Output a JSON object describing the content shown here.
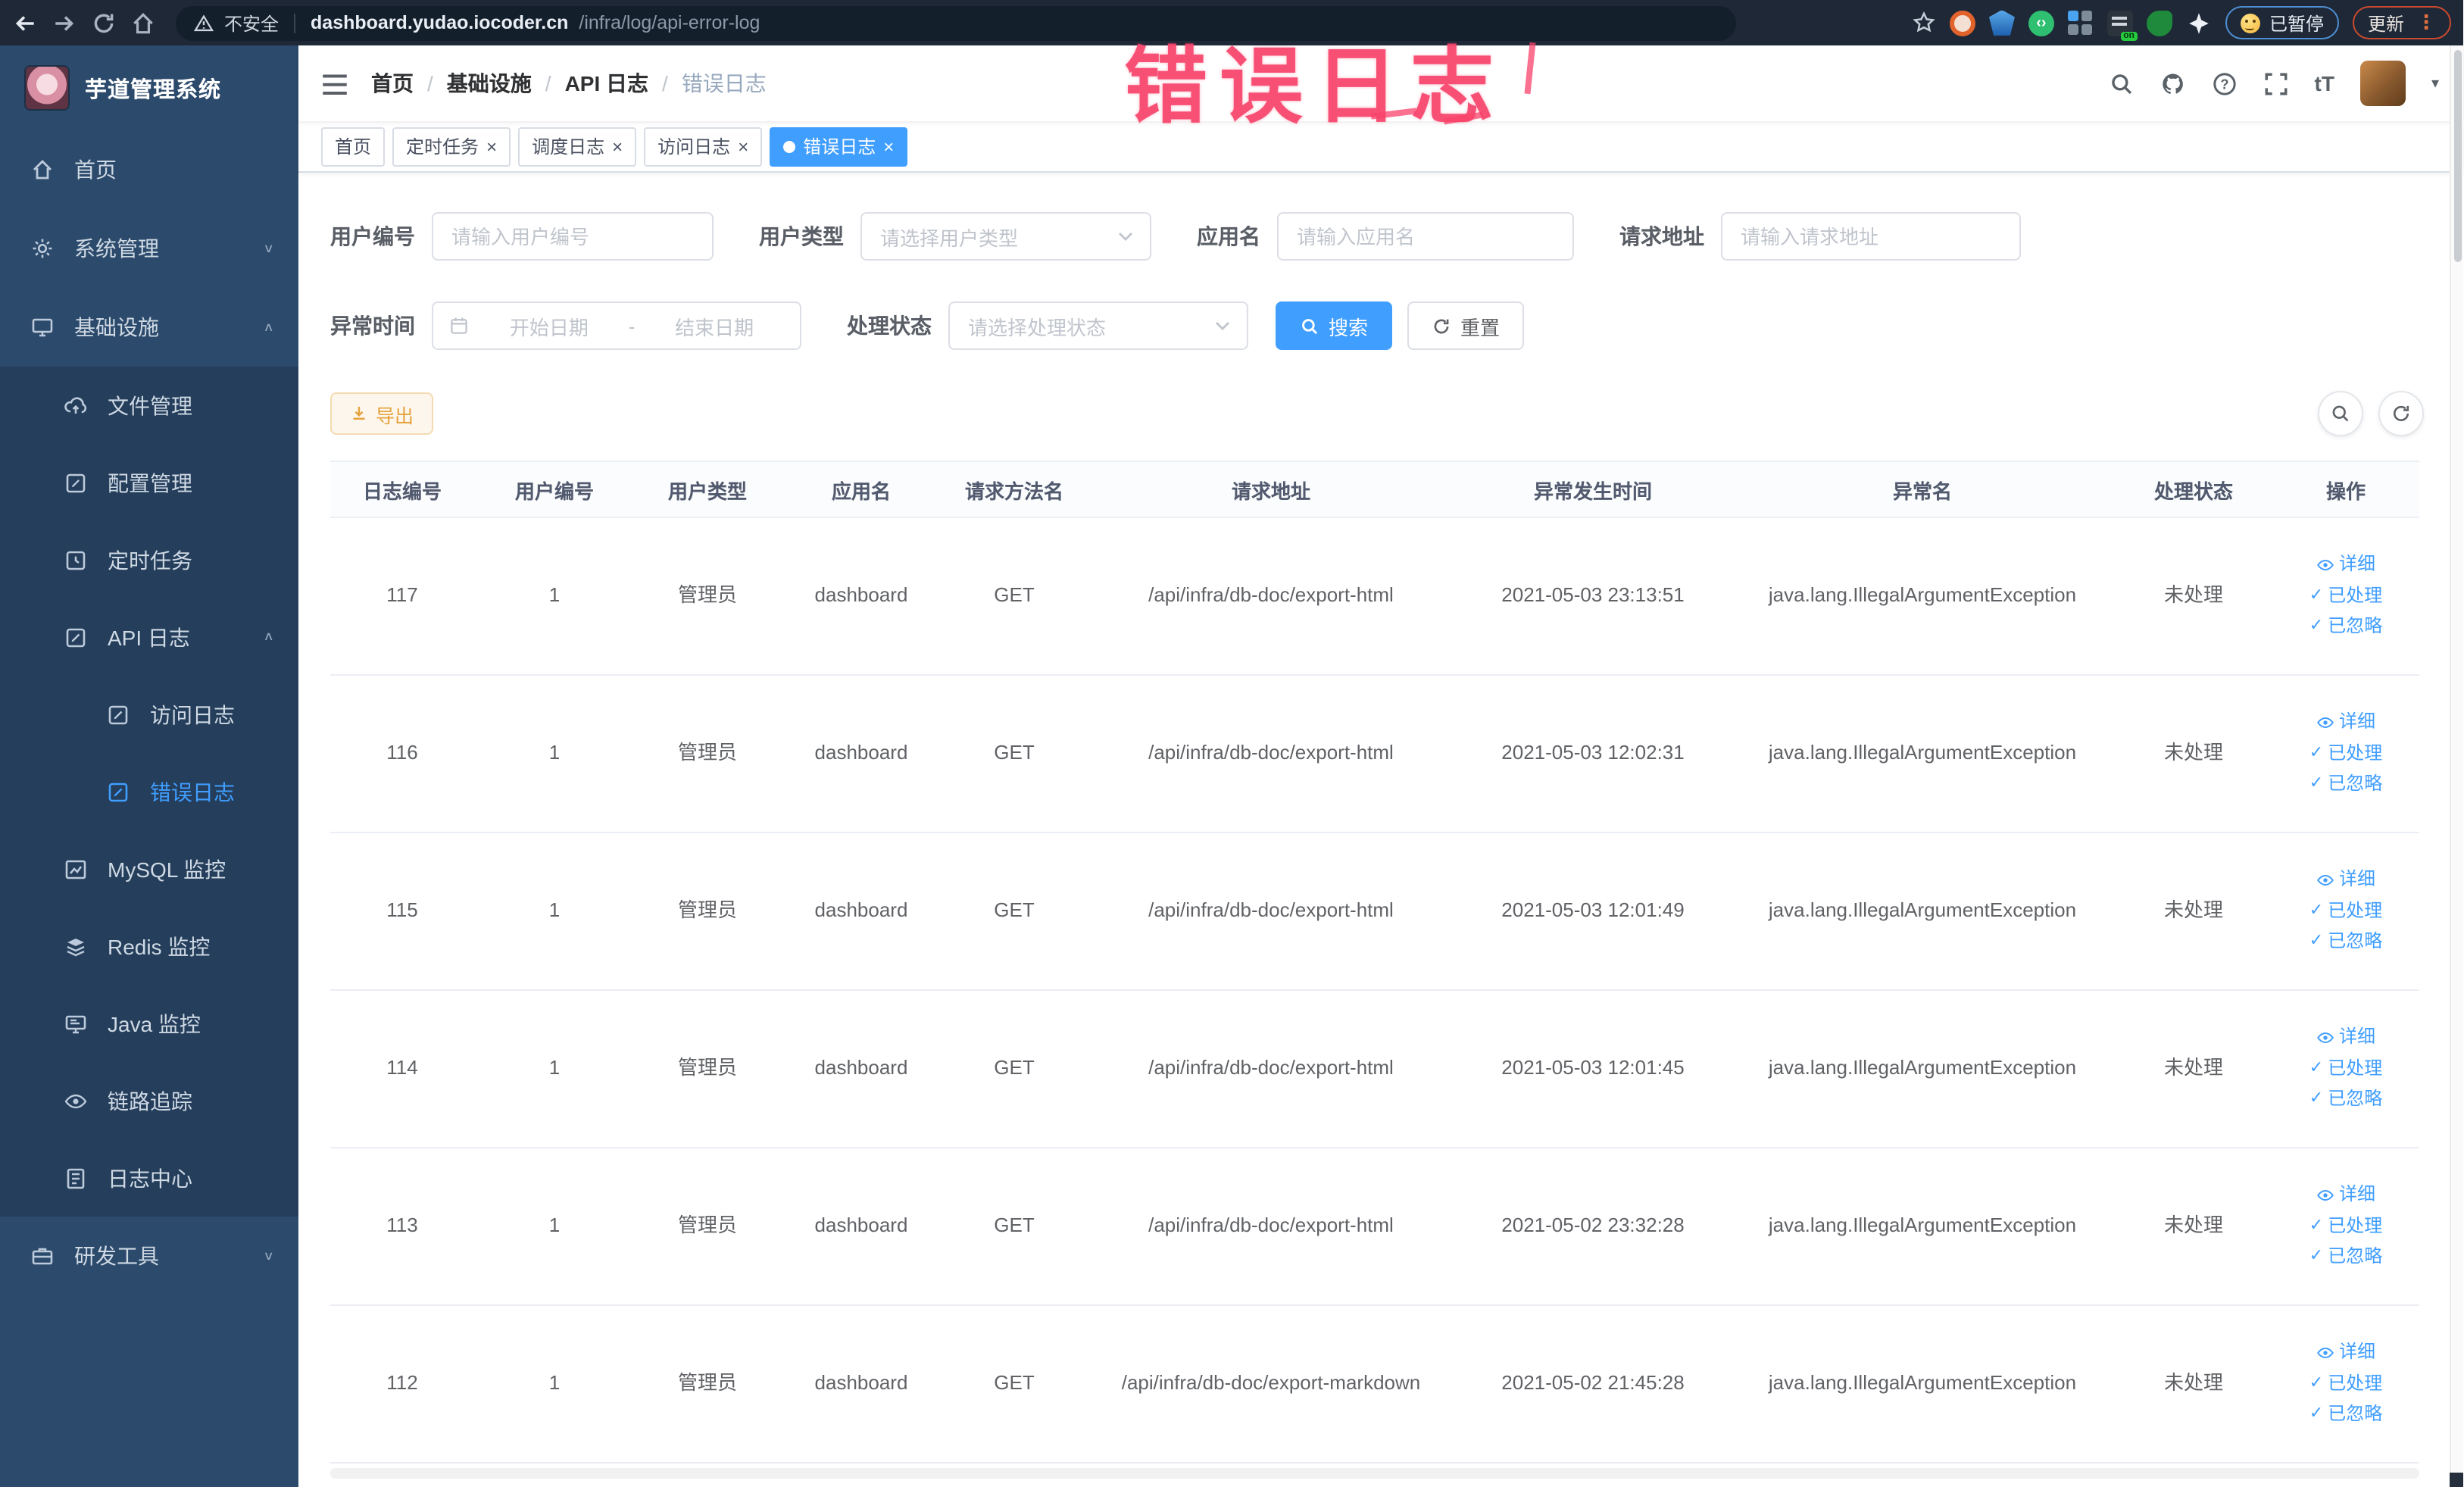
{
  "browser": {
    "security_label": "不安全",
    "url_host": "dashboard.yudao.iocoder.cn",
    "url_path": "/infra/log/api-error-log",
    "paused_label": "已暂停",
    "update_label": "更新",
    "on_badge": "on"
  },
  "annotation": {
    "text": "错误日志"
  },
  "glyphs": {
    "close": "×",
    "chevron_down": "∨",
    "chevron_up": "∧",
    "caret_down": "▾",
    "breadcrumb_sep": "/",
    "range_sep": "-",
    "check": "✓",
    "ellipsis_v": "⋮",
    "font_size_tool": "tT"
  },
  "sidebar": {
    "title": "芋道管理系统",
    "items": [
      {
        "label": "首页"
      },
      {
        "label": "系统管理"
      },
      {
        "label": "基础设施"
      },
      {
        "label": "文件管理"
      },
      {
        "label": "配置管理"
      },
      {
        "label": "定时任务"
      },
      {
        "label": "API 日志"
      },
      {
        "label": "访问日志"
      },
      {
        "label": "错误日志"
      },
      {
        "label": "MySQL 监控"
      },
      {
        "label": "Redis 监控"
      },
      {
        "label": "Java 监控"
      },
      {
        "label": "链路追踪"
      },
      {
        "label": "日志中心"
      },
      {
        "label": "研发工具"
      }
    ]
  },
  "breadcrumb": [
    "首页",
    "基础设施",
    "API 日志",
    "错误日志"
  ],
  "tabs": [
    {
      "label": "首页"
    },
    {
      "label": "定时任务"
    },
    {
      "label": "调度日志"
    },
    {
      "label": "访问日志"
    },
    {
      "label": "错误日志"
    }
  ],
  "filters": {
    "user_id": {
      "label": "用户编号",
      "placeholder": "请输入用户编号"
    },
    "user_type": {
      "label": "用户类型",
      "placeholder": "请选择用户类型"
    },
    "app_name": {
      "label": "应用名",
      "placeholder": "请输入应用名"
    },
    "request_url": {
      "label": "请求地址",
      "placeholder": "请输入请求地址"
    },
    "exception_time": {
      "label": "异常时间",
      "start_placeholder": "开始日期",
      "end_placeholder": "结束日期"
    },
    "process_status": {
      "label": "处理状态",
      "placeholder": "请选择处理状态"
    },
    "search_label": "搜索",
    "reset_label": "重置"
  },
  "toolbar": {
    "export_label": "导出"
  },
  "table": {
    "columns": [
      "日志编号",
      "用户编号",
      "用户类型",
      "应用名",
      "请求方法名",
      "请求地址",
      "异常发生时间",
      "异常名",
      "处理状态",
      "操作"
    ],
    "row_actions": [
      "详细",
      "已处理",
      "已忽略"
    ],
    "rows": [
      {
        "id": "117",
        "user_id": "1",
        "user_type": "管理员",
        "app": "dashboard",
        "method": "GET",
        "url": "/api/infra/db-doc/export-html",
        "time": "2021-05-03 23:13:51",
        "exception": "java.lang.IllegalArgumentException",
        "status": "未处理"
      },
      {
        "id": "116",
        "user_id": "1",
        "user_type": "管理员",
        "app": "dashboard",
        "method": "GET",
        "url": "/api/infra/db-doc/export-html",
        "time": "2021-05-03 12:02:31",
        "exception": "java.lang.IllegalArgumentException",
        "status": "未处理"
      },
      {
        "id": "115",
        "user_id": "1",
        "user_type": "管理员",
        "app": "dashboard",
        "method": "GET",
        "url": "/api/infra/db-doc/export-html",
        "time": "2021-05-03 12:01:49",
        "exception": "java.lang.IllegalArgumentException",
        "status": "未处理"
      },
      {
        "id": "114",
        "user_id": "1",
        "user_type": "管理员",
        "app": "dashboard",
        "method": "GET",
        "url": "/api/infra/db-doc/export-html",
        "time": "2021-05-03 12:01:45",
        "exception": "java.lang.IllegalArgumentException",
        "status": "未处理"
      },
      {
        "id": "113",
        "user_id": "1",
        "user_type": "管理员",
        "app": "dashboard",
        "method": "GET",
        "url": "/api/infra/db-doc/export-html",
        "time": "2021-05-02 23:32:28",
        "exception": "java.lang.IllegalArgumentException",
        "status": "未处理"
      },
      {
        "id": "112",
        "user_id": "1",
        "user_type": "管理员",
        "app": "dashboard",
        "method": "GET",
        "url": "/api/infra/db-doc/export-markdown",
        "time": "2021-05-02 21:45:28",
        "exception": "java.lang.IllegalArgumentException",
        "status": "未处理"
      }
    ]
  }
}
